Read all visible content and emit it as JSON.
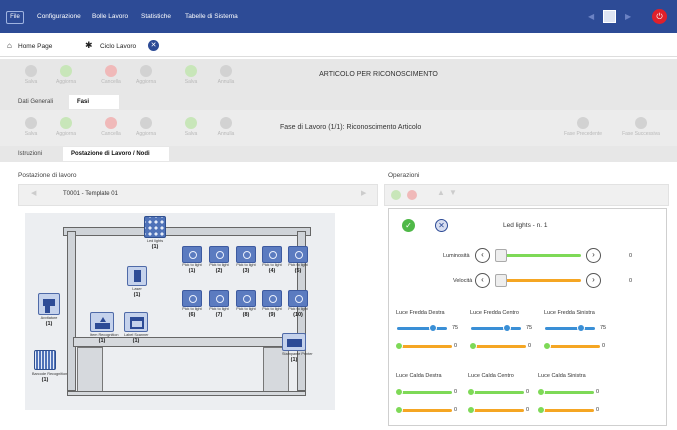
{
  "menubar": {
    "file": "File",
    "items": [
      "Configurazione",
      "Bolle Lavoro",
      "Statistiche",
      "Tabelle di Sistema"
    ]
  },
  "tabs": {
    "home": "Home Page",
    "ciclo": "Ciclo Lavoro"
  },
  "toolbar1": {
    "buttons": [
      "Salva",
      "Aggiorna",
      "Cancella",
      "Aggiorna",
      "Salva",
      "Annulla"
    ],
    "title": "ARTICOLO PER RICONOSCIMENTO"
  },
  "subtabs1": {
    "dati": "Dati Generali",
    "fasi": "Fasi"
  },
  "toolbar2": {
    "buttons": [
      "Salva",
      "Aggiorna",
      "Cancella",
      "Aggiorna",
      "Salva",
      "Annulla"
    ],
    "title": "Fase di Lavoro (1/1): Riconoscimento Articolo",
    "right": [
      "Fase Precedente",
      "Fase Successiva"
    ]
  },
  "subtabs2": {
    "istruzioni": "Istruzioni",
    "postazione": "Postazione di Lavoro / Nodi"
  },
  "left": {
    "title": "Postazione di lavoro",
    "template": "T0001 - Template 01"
  },
  "diagram": {
    "led_lights": {
      "caption": "Led lights",
      "num": "(1)"
    },
    "laser": {
      "caption": "Laser",
      "num": "(1)"
    },
    "avvitatore": {
      "caption": "Avvitatore",
      "num": "(1)"
    },
    "item_recognition": {
      "caption": "Item Recognition",
      "num": "(1)"
    },
    "label_scanner": {
      "caption": "Label Scanner",
      "num": "(1)"
    },
    "barcode": {
      "caption": "Barcode Recognition",
      "num": "(1)"
    },
    "printer": {
      "caption": "Stampante Printer",
      "num": "(1)"
    },
    "pick_top": [
      {
        "caption": "Pick to light",
        "num": "(1)"
      },
      {
        "caption": "Pick to light",
        "num": "(2)"
      },
      {
        "caption": "Pick to light",
        "num": "(3)"
      },
      {
        "caption": "Pick to light",
        "num": "(4)"
      },
      {
        "caption": "Pick to light",
        "num": "(5)"
      }
    ],
    "pick_bottom": [
      {
        "caption": "Pick to light",
        "num": "(6)"
      },
      {
        "caption": "Pick to light",
        "num": "(7)"
      },
      {
        "caption": "Pick to light",
        "num": "(8)"
      },
      {
        "caption": "Pick to light",
        "num": "(9)"
      },
      {
        "caption": "Pick to light",
        "num": "(10)"
      }
    ]
  },
  "right": {
    "title": "Operazioni",
    "device": "Led lights - n. 1",
    "luminosita": {
      "label": "Luminosità",
      "value": "0"
    },
    "velocita": {
      "label": "Velocità",
      "value": "0"
    },
    "fredda": [
      {
        "label": "Luce Fredda Destra",
        "blue": "75",
        "orange": "0"
      },
      {
        "label": "Luce Fredda Centro",
        "blue": "75",
        "orange": "0"
      },
      {
        "label": "Luce Fredda Sinistra",
        "blue": "75",
        "orange": "0"
      }
    ],
    "calda": [
      {
        "label": "Luce Calda Destra",
        "green": "0",
        "orange": "0"
      },
      {
        "label": "Luce Calda Centro",
        "green": "0",
        "orange": "0"
      },
      {
        "label": "Luce Calda Sinistra",
        "green": "0",
        "orange": "0"
      }
    ]
  },
  "colors": {
    "menubar": "#2d4b96",
    "blue": "#3a8fd6",
    "green": "#7ed957",
    "orange": "#f5a623",
    "red_power": "#e0202a"
  }
}
